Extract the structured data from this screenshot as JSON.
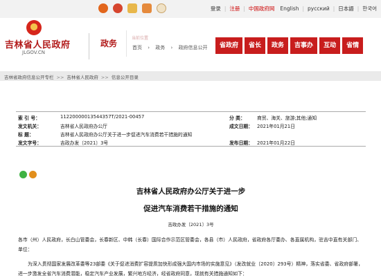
{
  "topbar": {
    "social_icons": [
      "wechat-icon",
      "weibo-icon",
      "app-icon",
      "email-icon",
      "mascot-icon"
    ],
    "links": {
      "login": "登录",
      "register": "注册",
      "china_gov": "中国政府网",
      "english": "English",
      "russian": "русский",
      "japanese": "日本語",
      "korean": "한국어"
    }
  },
  "header": {
    "site_title": "吉林省人民政府",
    "site_domain": "JLGOV.CN",
    "section_title": "政务",
    "watermark": "当前位置",
    "crumb": [
      "首页",
      "政务",
      "政府信息公开"
    ],
    "nav": [
      "省政府",
      "省长",
      "政务",
      "吉事办",
      "互动",
      "省情"
    ]
  },
  "breadcrumb": [
    "吉林省政府信息公开专栏",
    "吉林省人民政府",
    "信息公开目录"
  ],
  "meta": {
    "index_label": "索 引 号：",
    "index_value": "11220000013544357T/2021-00457",
    "category_label": "分 类：",
    "category_value": "商贸、海关、旅游;其他;通知",
    "agency_label": "发文机关：",
    "agency_value": "吉林省人民政府办公厅",
    "date_label": "成文日期：",
    "date_value": "2021年01月21日",
    "title_label": "标 题：",
    "title_value": "吉林省人民政府办公厅关于进一步促进汽车消费若干措施的通知",
    "docno_label": "发文字号：",
    "docno_value": "吉政办发〔2021〕3号",
    "publish_label": "发布日期：",
    "publish_value": "2021年01月22日"
  },
  "document": {
    "title_line1": "吉林省人民政府办公厅关于进一步",
    "title_line2": "促进汽车消费若干措施的通知",
    "doc_number": "吉政办发〔2021〕3号",
    "salutation": "各市（州）人民政府，长白山管委会，长春新区、中韩（长春）国际合作示范区管委会，各县（市）人民政府，省政府各厅委办、各直属机构，驻吉中直有关部门、单位：",
    "body": "为深入贯彻国家发展改革委等23部委《关于促进消费扩容提质加快形成强大国内市场的实施意见》（发改就业〔2020〕293号）精神，落实省委、省政府部署，进一步激发全省汽车消费潜能，稳定汽车产业发展，繁兴地方经济，经省政府同意，现就有关措施通知如下："
  }
}
